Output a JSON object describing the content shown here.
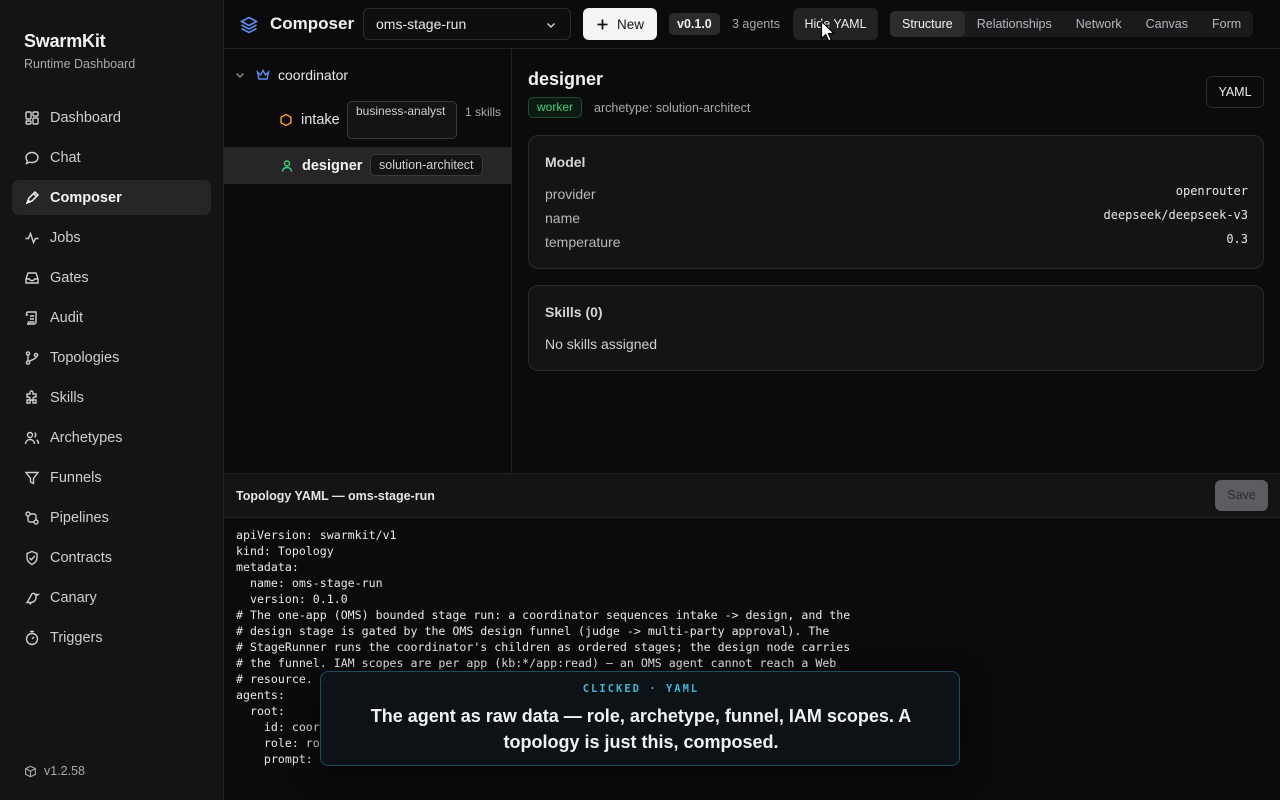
{
  "brand": {
    "title": "SwarmKit",
    "subtitle": "Runtime Dashboard",
    "version": "v1.2.58"
  },
  "sidebar": {
    "items": [
      {
        "label": "Dashboard",
        "icon": "layout-grid-icon",
        "active": false
      },
      {
        "label": "Chat",
        "icon": "chat-icon",
        "active": false
      },
      {
        "label": "Composer",
        "icon": "compose-icon",
        "active": true
      },
      {
        "label": "Jobs",
        "icon": "activity-icon",
        "active": false
      },
      {
        "label": "Gates",
        "icon": "inbox-icon",
        "active": false
      },
      {
        "label": "Audit",
        "icon": "scroll-icon",
        "active": false
      },
      {
        "label": "Topologies",
        "icon": "git-branch-icon",
        "active": false
      },
      {
        "label": "Skills",
        "icon": "puzzle-icon",
        "active": false
      },
      {
        "label": "Archetypes",
        "icon": "users-icon",
        "active": false
      },
      {
        "label": "Funnels",
        "icon": "funnel-icon",
        "active": false
      },
      {
        "label": "Pipelines",
        "icon": "workflow-icon",
        "active": false
      },
      {
        "label": "Contracts",
        "icon": "shield-check-icon",
        "active": false
      },
      {
        "label": "Canary",
        "icon": "bird-icon",
        "active": false
      },
      {
        "label": "Triggers",
        "icon": "timer-icon",
        "active": false
      }
    ]
  },
  "topbar": {
    "title": "Composer",
    "topology_select": "oms-stage-run",
    "new_label": "New",
    "version_badge": "v0.1.0",
    "agents_count": "3 agents",
    "hide_yaml_label": "Hide YAML",
    "tabs": [
      {
        "label": "Structure",
        "active": true
      },
      {
        "label": "Relationships",
        "active": false
      },
      {
        "label": "Network",
        "active": false
      },
      {
        "label": "Canvas",
        "active": false
      },
      {
        "label": "Form",
        "active": false
      }
    ]
  },
  "tree": {
    "coordinator": {
      "label": "coordinator"
    },
    "intake": {
      "label": "intake",
      "archetype": "business-analyst",
      "skills": "1 skills"
    },
    "designer": {
      "label": "designer",
      "archetype": "solution-architect"
    }
  },
  "detail": {
    "name": "designer",
    "role": "worker",
    "archetype_line": "archetype: solution-architect",
    "yaml_button": "YAML",
    "model": {
      "title": "Model",
      "rows": [
        {
          "key": "provider",
          "value": "openrouter"
        },
        {
          "key": "name",
          "value": "deepseek/deepseek-v3"
        },
        {
          "key": "temperature",
          "value": "0.3"
        }
      ]
    },
    "skills": {
      "title": "Skills (0)",
      "empty": "No skills assigned"
    }
  },
  "yaml_panel": {
    "title": "Topology YAML — oms-stage-run",
    "save_label": "Save",
    "code": "apiVersion: swarmkit/v1\nkind: Topology\nmetadata:\n  name: oms-stage-run\n  version: 0.1.0\n# The one-app (OMS) bounded stage run: a coordinator sequences intake -> design, and the\n# design stage is gated by the OMS design funnel (judge -> multi-party approval). The\n# StageRunner runs the coordinator's children as ordered stages; the design node carries\n# the funnel. IAM scopes are per app (kb:*/app:read) — an OMS agent cannot reach a Web\n# resource. S\nagents:\n  root:\n    id: coor\n    role: ro\n    prompt: "
  },
  "tooltip": {
    "kicker": "CLICKED · YAML",
    "text": "The agent as raw data — role, archetype, funnel, IAM scopes. A topology is just this, composed."
  },
  "colors": {
    "accent_green": "#3fce7a",
    "accent_cyan": "#3fb6d6",
    "background": "#0b0b0c",
    "sidebar": "#141415"
  }
}
